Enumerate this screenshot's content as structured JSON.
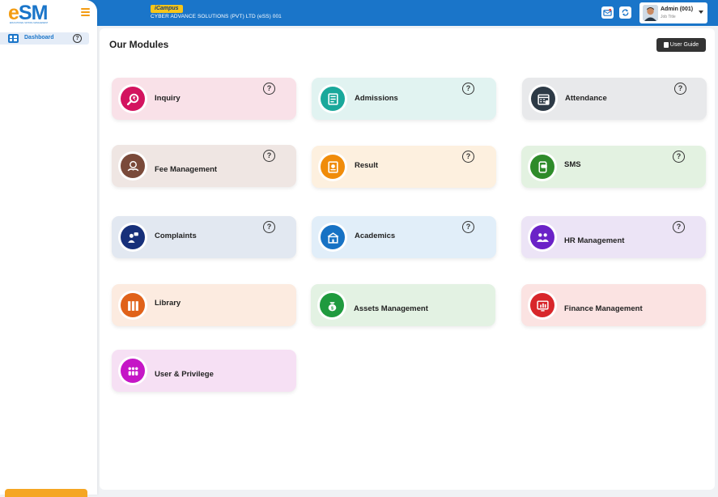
{
  "header": {
    "brand_badge": "iCampus",
    "company": "CYBER ADVANCE SOLUTIONS (PVT) LTD (eSS) 001",
    "user_name": "Admin (001)",
    "user_role": "Job Title"
  },
  "sidebar": {
    "logo": "eSM",
    "logo_tagline": "EDUCATIONAL SCHOOL MANAGEMENT",
    "items": [
      {
        "label": "Dashboard",
        "help": "?"
      }
    ]
  },
  "main": {
    "title": "Our Modules",
    "guide_label": "User Guide",
    "modules": [
      {
        "label": "Inquiry",
        "help": "?",
        "bg": "#f9e1e8",
        "icon_bg": "#d3135f",
        "icon": "search-icon"
      },
      {
        "label": "Admissions",
        "help": "?",
        "bg": "#e1f3f1",
        "icon_bg": "#1aa89b",
        "icon": "document-icon"
      },
      {
        "label": "Attendance",
        "help": "?",
        "bg": "#e8e9eb",
        "icon_bg": "#2d3a46",
        "icon": "calendar-icon"
      },
      {
        "label": "Fee Management",
        "help": "?",
        "bg": "#efe6e3",
        "icon_bg": "#7a4a3a",
        "icon": "money-hand-icon"
      },
      {
        "label": "Result",
        "help": "?",
        "bg": "#fdf0df",
        "icon_bg": "#f08c0a",
        "icon": "certificate-icon"
      },
      {
        "label": "SMS",
        "help": "?",
        "bg": "#e3f2e1",
        "icon_bg": "#2e8b2a",
        "icon": "sms-icon"
      },
      {
        "label": "Complaints",
        "help": "?",
        "bg": "#e2e8f1",
        "icon_bg": "#17307a",
        "icon": "complaint-icon"
      },
      {
        "label": "Academics",
        "help": "?",
        "bg": "#e1eef9",
        "icon_bg": "#1772c4",
        "icon": "school-icon"
      },
      {
        "label": "HR Management",
        "help": "?",
        "bg": "#ece4f6",
        "icon_bg": "#6a22c7",
        "icon": "people-icon"
      },
      {
        "label": "Library",
        "help": "",
        "bg": "#fcebe0",
        "icon_bg": "#e0621a",
        "icon": "books-icon"
      },
      {
        "label": "Assets Management",
        "help": "",
        "bg": "#e3f2e3",
        "icon_bg": "#1f9a3e",
        "icon": "money-bag-icon"
      },
      {
        "label": "Finance Management",
        "help": "",
        "bg": "#fbe3e2",
        "icon_bg": "#d8262a",
        "icon": "finance-chart-icon"
      },
      {
        "label": "User & Privilege",
        "help": "",
        "bg": "#f6e0f4",
        "icon_bg": "#c516c6",
        "icon": "user-group-icon"
      }
    ]
  }
}
